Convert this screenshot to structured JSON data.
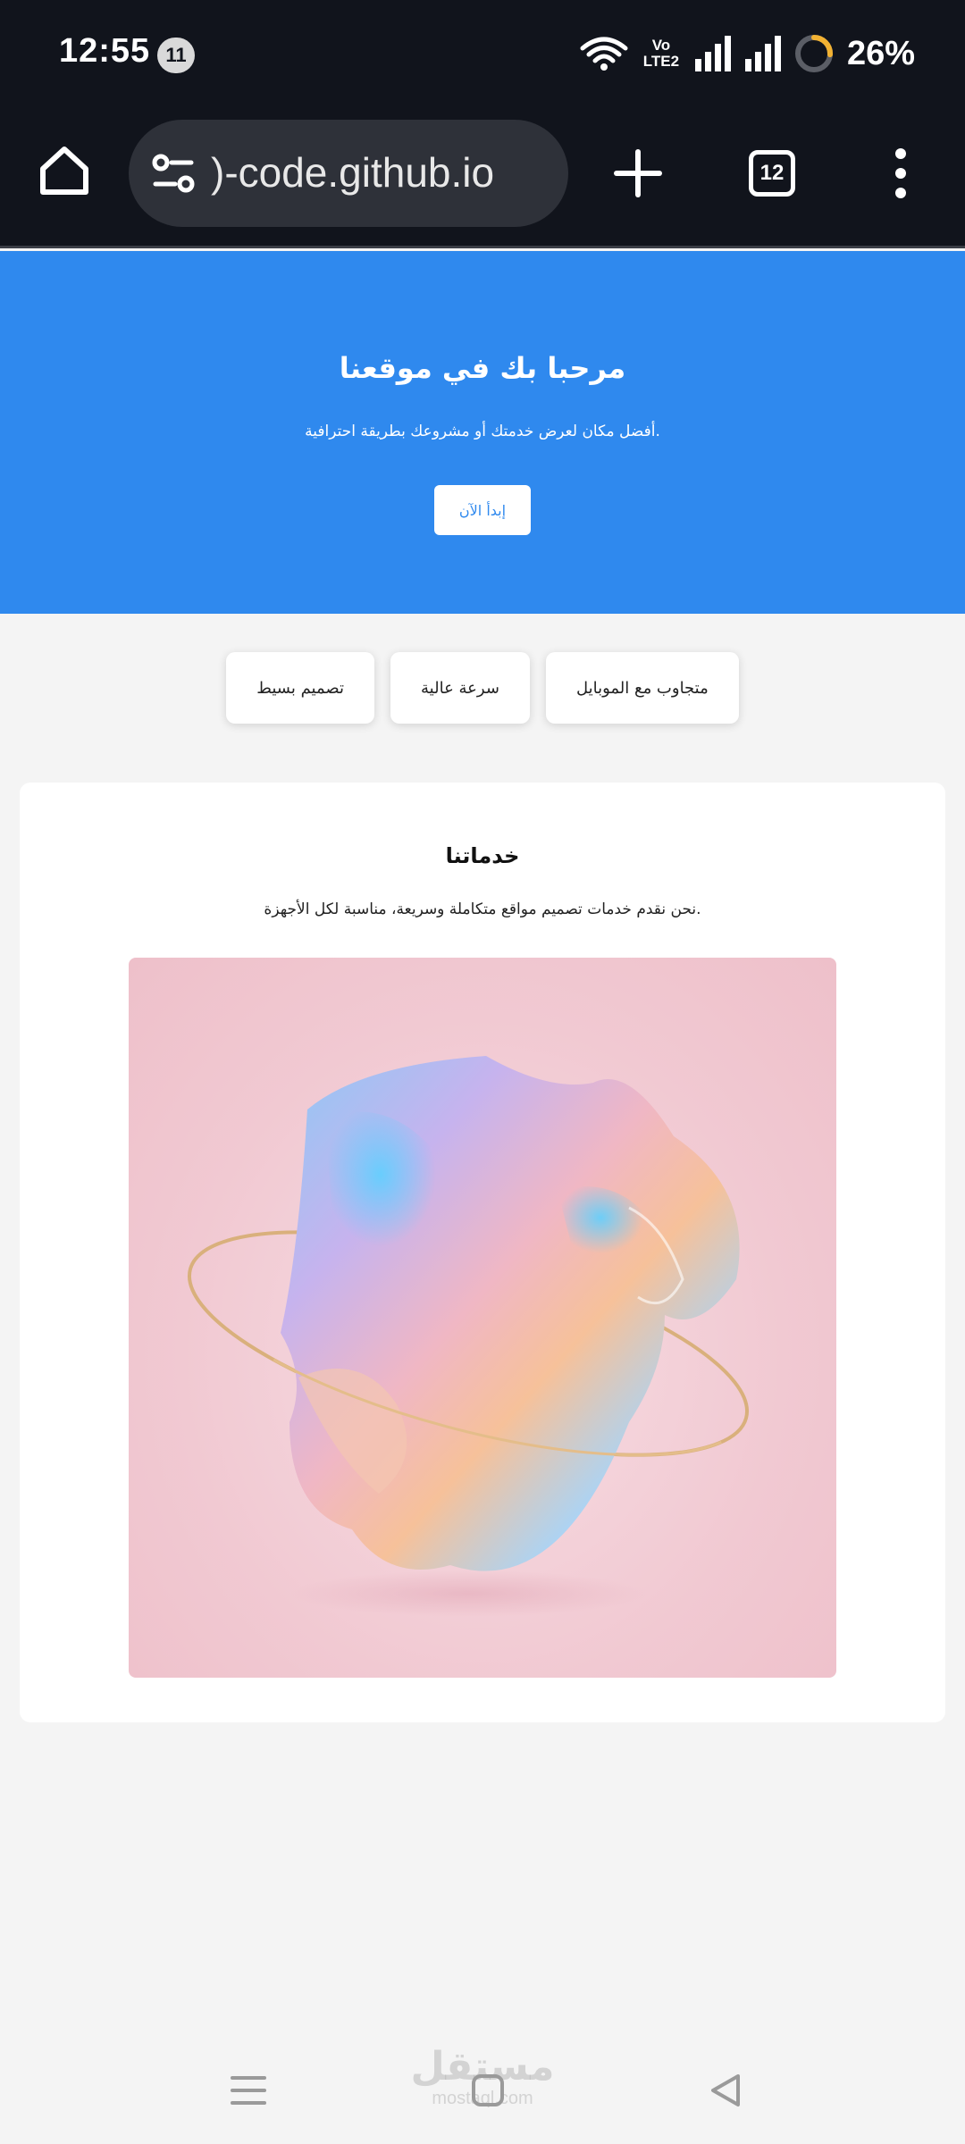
{
  "status_bar": {
    "time": "12:55",
    "notification_count": "11",
    "network_label": "Vo LTE2",
    "battery": "26%",
    "battery_level": 0.26
  },
  "browser": {
    "url": ")-code.github.io",
    "tab_count": "12"
  },
  "hero": {
    "title": "مرحبا بك في موقعنا",
    "subtitle": ".أفضل مكان لعرض خدمتك أو مشروعك بطريقة احترافية",
    "cta_label": "إبدأ الآن",
    "color": "#2f89ee"
  },
  "features": [
    {
      "label": "متجاوب مع الموبايل"
    },
    {
      "label": "سرعة عالية"
    },
    {
      "label": "تصميم بسيط"
    }
  ],
  "services": {
    "title": "خدماتنا",
    "text": ".نحن نقدم خدمات تصميم مواقع متكاملة وسريعة، مناسبة لكل الأجهزة"
  },
  "watermark": {
    "main": "مستقل",
    "sub": "mostaql.com"
  }
}
